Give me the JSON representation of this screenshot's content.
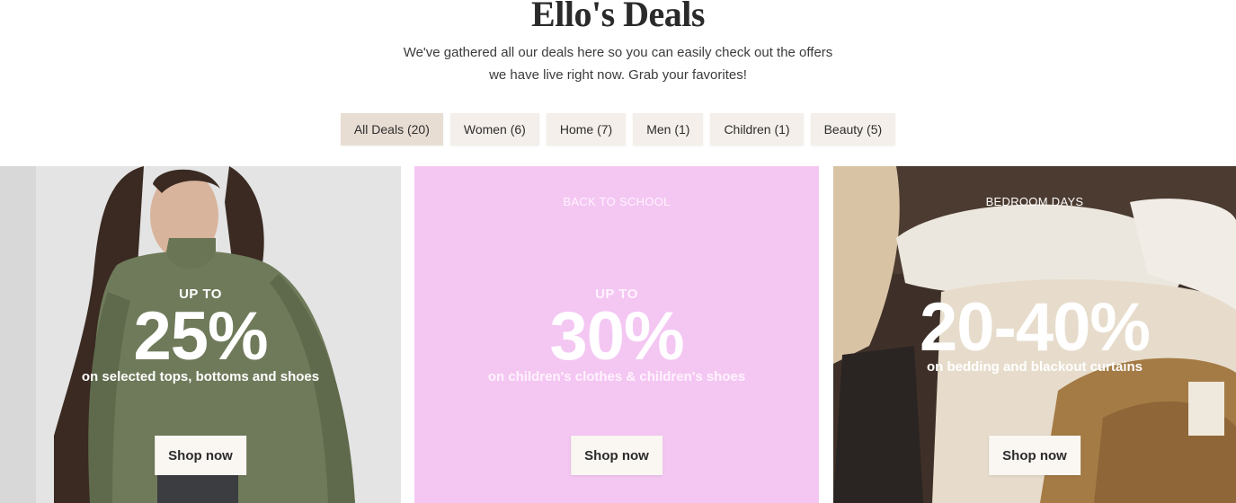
{
  "page": {
    "title": "Ello's Deals",
    "intro_line1": "We've gathered all our deals here so you can easily check out the offers",
    "intro_line2": "we have live right now. Grab your favorites!"
  },
  "filters": [
    {
      "label": "All Deals (20)",
      "active": true
    },
    {
      "label": "Women (6)",
      "active": false
    },
    {
      "label": "Home (7)",
      "active": false
    },
    {
      "label": "Men (1)",
      "active": false
    },
    {
      "label": "Children (1)",
      "active": false
    },
    {
      "label": "Beauty (5)",
      "active": false
    }
  ],
  "deals": [
    {
      "eyebrow": "",
      "upto": "UP TO",
      "value": "25%",
      "subtitle": "on selected tops, bottoms and shoes",
      "cta": "Shop now",
      "image": "woman-in-green-sweater"
    },
    {
      "eyebrow": "BACK TO SCHOOL",
      "upto": "UP TO",
      "value": "30%",
      "subtitle": "on children's clothes & children's shoes",
      "cta": "Shop now",
      "image": "pink-background"
    },
    {
      "eyebrow": "BEDROOM DAYS",
      "upto": "",
      "value": "20-40%",
      "subtitle": "on bedding and blackout curtains",
      "cta": "Shop now",
      "image": "bedroom-bedding"
    }
  ],
  "colors": {
    "chip_bg": "#f4efea",
    "chip_active_bg": "#e8ddd3",
    "promo_pink": "#f4c7f3",
    "button_bg": "#faf6f2"
  }
}
